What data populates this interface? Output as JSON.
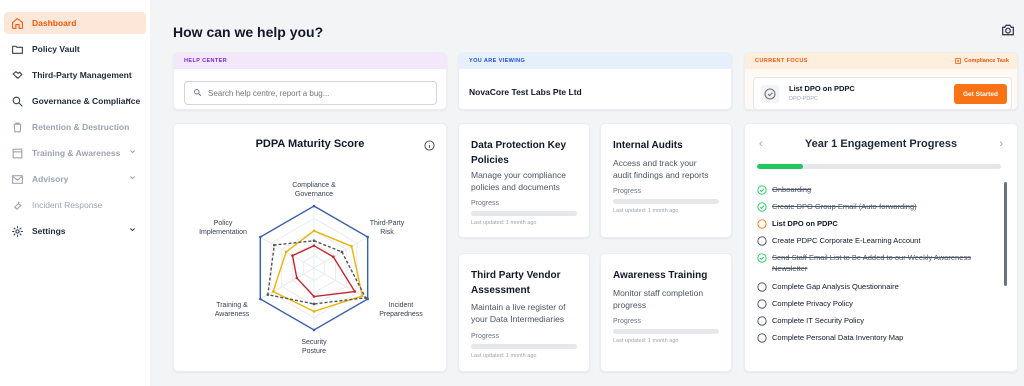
{
  "sidebar": {
    "items": [
      {
        "label": "Dashboard",
        "icon": "home-icon"
      },
      {
        "label": "Policy Vault",
        "icon": "folder-icon"
      },
      {
        "label": "Third-Party Management",
        "icon": "handshake-icon"
      },
      {
        "label": "Governance & Compliance",
        "icon": "search-icon"
      },
      {
        "label": "Retention & Destruction",
        "icon": "trash-icon"
      },
      {
        "label": "Training & Awareness",
        "icon": "book-icon"
      },
      {
        "label": "Advisory",
        "icon": "mail-icon"
      },
      {
        "label": "Incident Response",
        "icon": "wrench-icon"
      },
      {
        "label": "Settings",
        "icon": "gear-icon"
      }
    ]
  },
  "header": {
    "title": "How can we help you?"
  },
  "help_center": {
    "tag": "HELP CENTER",
    "placeholder": "Search help centre, report a bug..."
  },
  "viewing": {
    "tag": "YOU ARE VIEWING",
    "org": "NovaCore Test Labs Pte Ltd"
  },
  "focus": {
    "tag": "CURRENT FOCUS",
    "task_type": "Compliance Task",
    "title": "List DPO on PDPC",
    "code": "DPO-PDPC",
    "button": "Get Started"
  },
  "maturity": {
    "title": "PDPA Maturity Score",
    "axes": [
      [
        "Compliance &",
        "Governance"
      ],
      [
        "Third-Party",
        "Risk"
      ],
      [
        "Incident",
        "Preparedness"
      ],
      [
        "Security",
        "Posture"
      ],
      [
        "Training &",
        "Awareness"
      ],
      [
        "Policy",
        "Implementation"
      ]
    ]
  },
  "chart_data": {
    "type": "radar",
    "title": "PDPA Maturity Score",
    "categories": [
      "Compliance & Governance",
      "Third-Party Risk",
      "Incident Preparedness",
      "Security Posture",
      "Training & Awareness",
      "Policy Implementation"
    ],
    "rlim": [
      0,
      5
    ],
    "series": [
      {
        "values": [
          5,
          5,
          5,
          5,
          5,
          5
        ],
        "color": "#3b5ea8",
        "style": "solid"
      },
      {
        "values": [
          3,
          3.5,
          4.5,
          3.5,
          3.8,
          2.6
        ],
        "color": "#eab308",
        "style": "solid"
      },
      {
        "values": [
          2.2,
          2.6,
          4.8,
          2.9,
          4.3,
          3.7
        ],
        "color": "#555555",
        "style": "dashed"
      },
      {
        "values": [
          1.8,
          1.8,
          3.8,
          2.3,
          1.6,
          2.0
        ],
        "color": "#c0262d",
        "style": "solid"
      }
    ],
    "grid": true
  },
  "modules": [
    {
      "title": [
        "Data Protection Key",
        "Policies"
      ],
      "desc": [
        "Manage your compliance",
        "policies and documents"
      ],
      "progress_label": "Progress",
      "progress": 0,
      "updated": "Last updated: 1 month ago"
    },
    {
      "title": [
        "Internal Audits"
      ],
      "desc": [
        "Access and track your",
        "audit findings and reports"
      ],
      "progress_label": "Progress",
      "progress": 0,
      "updated": "Last updated: 1 month ago"
    },
    {
      "title": [
        "Third Party Vendor",
        "Assessment"
      ],
      "desc": [
        "Maintain a live register of",
        "your Data Intermediaries"
      ],
      "progress_label": "Progress",
      "progress": 0,
      "updated": "Last updated: 1 month ago"
    },
    {
      "title": [
        "Awareness Training"
      ],
      "desc": [
        "Monitor staff completion",
        "progress"
      ],
      "progress_label": "Progress",
      "progress": 0,
      "updated": "Last updated: 1 month ago"
    }
  ],
  "engagement": {
    "title": "Year 1 Engagement Progress",
    "progress": 0.19,
    "tasks": [
      {
        "label": "Onboarding",
        "status": "done"
      },
      {
        "label": "Create DPO Group Email (Auto-forwarding)",
        "status": "done"
      },
      {
        "label": "List DPO on PDPC",
        "status": "current"
      },
      {
        "label": "Create PDPC Corporate E-Learning Account",
        "status": "todo"
      },
      {
        "label": "Send Staff Email List to Be Added to our Weekly Awareness Newsletter",
        "status": "done"
      },
      {
        "label": "Complete Gap Analysis Questionnaire",
        "status": "todo"
      },
      {
        "label": "Complete Privacy Policy",
        "status": "todo"
      },
      {
        "label": "Complete IT Security Policy",
        "status": "todo"
      },
      {
        "label": "Complete Personal Data Inventory Map",
        "status": "todo"
      }
    ]
  },
  "colors": {
    "accent": "#f97316",
    "active_bg": "#fde7d8",
    "success": "#22c55e"
  }
}
